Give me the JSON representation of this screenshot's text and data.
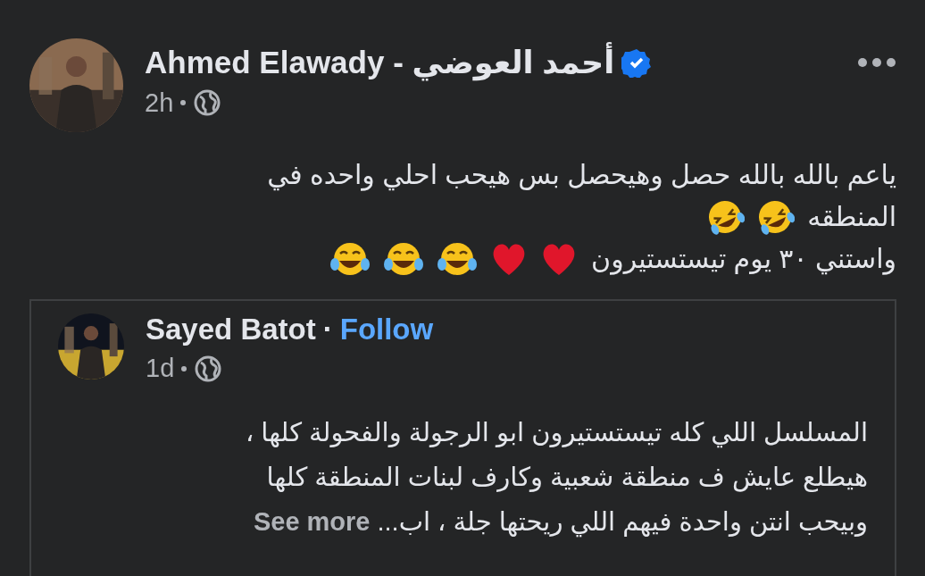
{
  "post": {
    "author": "Ahmed Elawady -  أحمد العوضي",
    "verified": true,
    "time": "2h",
    "lines": [
      {
        "text": "ياعم  بالله بالله حصل  وهيحصل بس هيحب احلي واحده في"
      },
      {
        "text": "المنطقه",
        "emojis": [
          {
            "kind": "rofl"
          },
          {
            "kind": "rofl"
          }
        ]
      },
      {
        "text": "واستني ٣٠ يوم تيستستيرون",
        "emojis": [
          {
            "kind": "heart"
          },
          {
            "kind": "heart"
          },
          {
            "kind": "joy"
          },
          {
            "kind": "joy"
          },
          {
            "kind": "joy"
          }
        ]
      }
    ]
  },
  "shared_post": {
    "author": "Sayed Batot",
    "separator": "·",
    "follow": "Follow",
    "time": "1d",
    "lines": [
      "المسلسل اللي كله تيستستيرون ابو الرجولة والفحولة كلها ،",
      "هيطلع عايش ف منطقة شعبية وكارف لبنات المنطقة كلها",
      "وبيحب انتن واحدة فيهم اللي ريحتها جلة ، اب..."
    ],
    "see_more": "See more"
  }
}
